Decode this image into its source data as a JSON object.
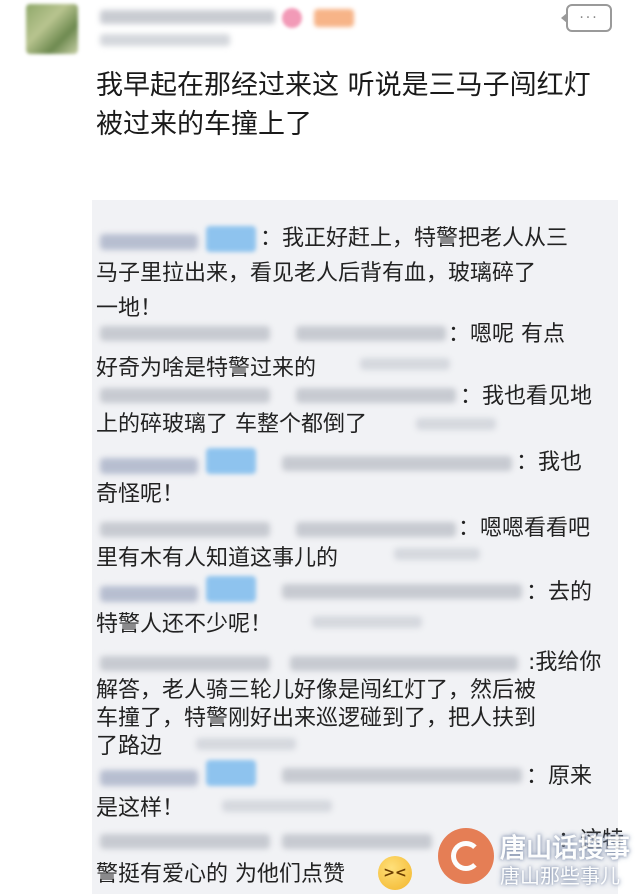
{
  "post": {
    "body": "我早起在那经过来这 听说是三马子闯红灯 被过来的车撞上了",
    "comment_button_label": "···"
  },
  "replies": [
    {
      "lines": [
        "：我正好赶上，特警把老人从三",
        "马子里拉出来，看见老人后背有血，玻璃碎了",
        "一地！"
      ]
    },
    {
      "lines": [
        "：嗯呢 有点",
        "好奇为啥是特警过来的"
      ]
    },
    {
      "lines": [
        "：我也看见地",
        "上的碎玻璃了 车整个都倒了"
      ]
    },
    {
      "lines": [
        "：我也",
        "奇怪呢！"
      ]
    },
    {
      "lines": [
        "：嗯嗯看看吧",
        "里有木有人知道这事儿的"
      ]
    },
    {
      "lines": [
        "：去的",
        "特警人还不少呢！"
      ]
    },
    {
      "lines": [
        ":我给你",
        "解答，老人骑三轮儿好像是闯红灯了，然后被",
        "车撞了，特警刚好出来巡逻碰到了，把人扶到",
        "了路边"
      ]
    },
    {
      "lines": [
        "：原来",
        "是这样！"
      ]
    },
    {
      "lines": [
        "：这特",
        "警挺有爱心的 为他们点赞"
      ]
    }
  ],
  "icons": {
    "comment": "comment-bubble-icon",
    "emoji": "angry-face-emoji-icon",
    "watermark_logo": "watermark-logo-icon"
  },
  "watermark": {
    "title": "唐山话搜事",
    "subtitle": "唐山那些事儿"
  },
  "colors": {
    "reply_background": "#f1f2f5",
    "vip_badge": "#8ec3ee",
    "username_blur": "#b7bed0"
  }
}
